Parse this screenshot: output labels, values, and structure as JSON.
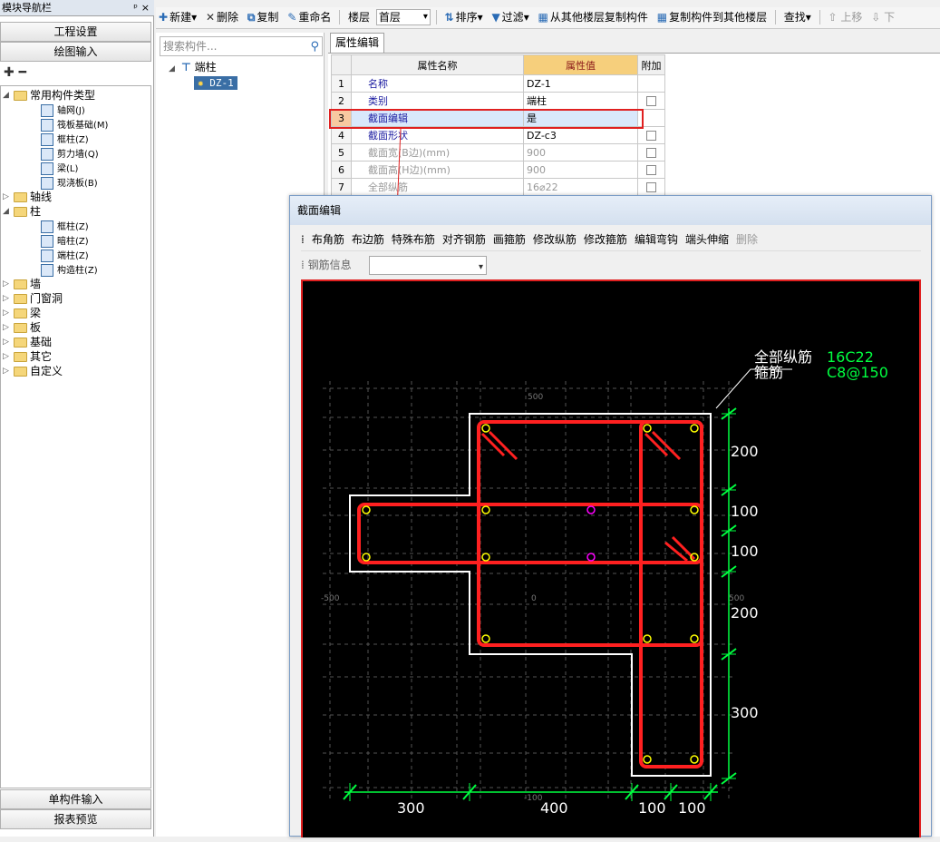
{
  "nav": {
    "title": "模块导航栏",
    "pin": "ᵖ",
    "close": "×",
    "btn_project": "工程设置",
    "btn_draw": "绘图输入",
    "btn_single": "单构件输入",
    "btn_report": "报表预览",
    "tools": "✚ ━"
  },
  "tree": [
    {
      "label": "常用构件类型",
      "level": 1,
      "expand": "◢",
      "folder": true
    },
    {
      "label": "轴网(J)",
      "level": 2
    },
    {
      "label": "筏板基础(M)",
      "level": 2
    },
    {
      "label": "框柱(Z)",
      "level": 2
    },
    {
      "label": "剪力墙(Q)",
      "level": 2
    },
    {
      "label": "梁(L)",
      "level": 2
    },
    {
      "label": "现浇板(B)",
      "level": 2
    },
    {
      "label": "轴线",
      "level": 1,
      "expand": "▷",
      "folder": true
    },
    {
      "label": "柱",
      "level": 1,
      "expand": "◢",
      "folder": true
    },
    {
      "label": "框柱(Z)",
      "level": 2
    },
    {
      "label": "暗柱(Z)",
      "level": 2
    },
    {
      "label": "端柱(Z)",
      "level": 2
    },
    {
      "label": "构造柱(Z)",
      "level": 2
    },
    {
      "label": "墙",
      "level": 1,
      "expand": "▷",
      "folder": true
    },
    {
      "label": "门窗洞",
      "level": 1,
      "expand": "▷",
      "folder": true
    },
    {
      "label": "梁",
      "level": 1,
      "expand": "▷",
      "folder": true
    },
    {
      "label": "板",
      "level": 1,
      "expand": "▷",
      "folder": true
    },
    {
      "label": "基础",
      "level": 1,
      "expand": "▷",
      "folder": true
    },
    {
      "label": "其它",
      "level": 1,
      "expand": "▷",
      "folder": true
    },
    {
      "label": "自定义",
      "level": 1,
      "expand": "▷",
      "folder": true
    }
  ],
  "toolbar": {
    "new": "新建",
    "delete": "删除",
    "copy": "复制",
    "rename": "重命名",
    "floor_label": "楼层",
    "floor_value": "首层",
    "sort": "排序",
    "filter": "过滤",
    "copy_from": "从其他楼层复制构件",
    "copy_to": "复制构件到其他楼层",
    "find": "查找",
    "up": "上移",
    "down": "下"
  },
  "comp": {
    "search_placeholder": "搜索构件...",
    "root": "端柱",
    "item": "DZ-1"
  },
  "prop": {
    "tab": "属性编辑",
    "headers": [
      "属性名称",
      "属性值",
      "附加"
    ],
    "rows": [
      {
        "n": "1",
        "k": "名称",
        "v": "DZ-1",
        "chk": false
      },
      {
        "n": "2",
        "k": "类别",
        "v": "端柱",
        "chk": true
      },
      {
        "n": "3",
        "k": "截面编辑",
        "v": "是",
        "chk": false
      },
      {
        "n": "4",
        "k": "截面形状",
        "v": "DZ-c3",
        "chk": true
      },
      {
        "n": "5",
        "k": "截面宽(B边)(mm)",
        "v": "900",
        "chk": true
      },
      {
        "n": "6",
        "k": "截面高(H边)(mm)",
        "v": "900",
        "chk": true
      },
      {
        "n": "7",
        "k": "全部纵筋",
        "v": "16⌀22",
        "chk": true
      }
    ]
  },
  "dialog": {
    "title": "截面编辑",
    "tools": [
      "布角筋",
      "布边筋",
      "特殊布筋",
      "对齐钢筋",
      "画箍筋",
      "修改纵筋",
      "修改箍筋",
      "编辑弯钩",
      "端头伸缩",
      "删除"
    ],
    "rebar_info": "钢筋信息"
  },
  "drawing": {
    "label_long": "全部纵筋",
    "val_long": "16C22",
    "label_stirrup": "箍筋",
    "val_stirrup": "C8@150",
    "dims_v": [
      "200",
      "100",
      "100",
      "200",
      "300"
    ],
    "dims_h": [
      "300",
      "400",
      "100",
      "100"
    ],
    "faint": [
      "500",
      "-500",
      "0",
      "500",
      "-100"
    ],
    "colors": {
      "rebar": "#ff2020",
      "dim": "#00ff40",
      "outline": "#ffffff",
      "grid": "#555555",
      "point": "#ffff00",
      "special": "#ff00ff"
    }
  }
}
